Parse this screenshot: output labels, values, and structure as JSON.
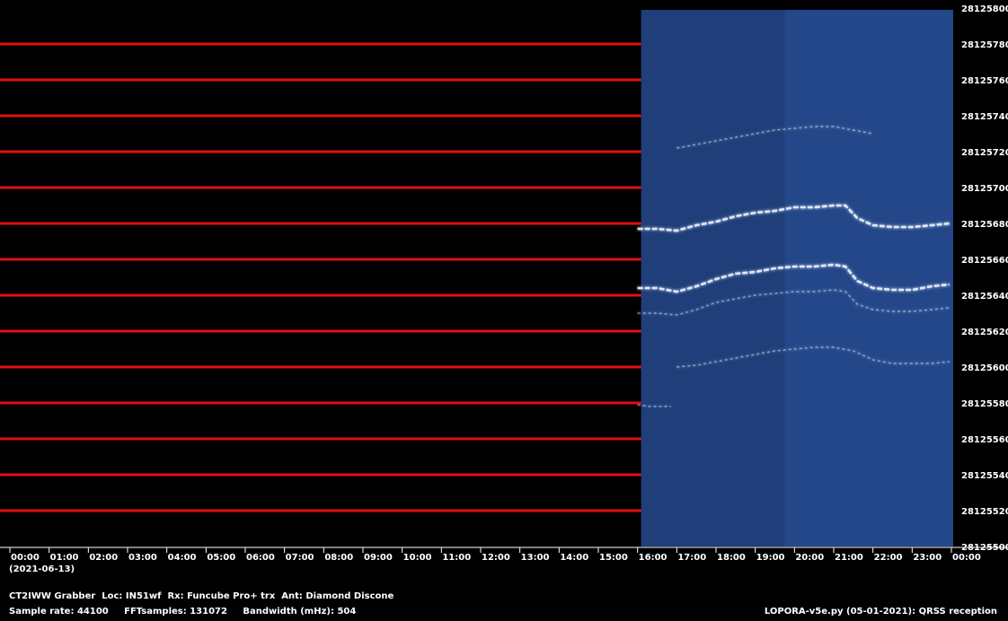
{
  "chart_data": {
    "type": "heatmap",
    "title": "",
    "xlabel": "",
    "ylabel": "",
    "date_label": "(2021-06-13)",
    "x_ticks": [
      "00:00",
      "01:00",
      "02:00",
      "03:00",
      "04:00",
      "05:00",
      "06:00",
      "07:00",
      "08:00",
      "09:00",
      "10:00",
      "11:00",
      "12:00",
      "13:00",
      "14:00",
      "15:00",
      "16:00",
      "17:00",
      "18:00",
      "19:00",
      "20:00",
      "21:00",
      "22:00",
      "23:00",
      "00:00"
    ],
    "x_range_hours": [
      0,
      24
    ],
    "y_ticks": [
      28125500,
      28125520,
      28125540,
      28125560,
      28125580,
      28125600,
      28125620,
      28125640,
      28125660,
      28125680,
      28125700,
      28125720,
      28125740,
      28125760,
      28125780,
      28125800
    ],
    "y_range": [
      28125500,
      28125800
    ],
    "data_start_hour": 16.0,
    "data_end_hour": 24.0,
    "signals": [
      {
        "hours": [
          16.0,
          16.5,
          17.0,
          17.5,
          18.0,
          18.5,
          19.0,
          19.5,
          20.0,
          20.5,
          21.0,
          21.3,
          21.6,
          22.0,
          22.5,
          23.0,
          23.5,
          23.95
        ],
        "values": [
          28125677,
          28125677,
          28125676,
          28125679,
          28125681,
          28125684,
          28125686,
          28125687,
          28125689,
          28125689,
          28125690,
          28125690,
          28125683,
          28125679,
          28125678,
          28125678,
          28125679,
          28125680
        ]
      },
      {
        "hours": [
          16.0,
          16.5,
          17.0,
          17.5,
          18.0,
          18.5,
          19.0,
          19.5,
          20.0,
          20.5,
          21.0,
          21.3,
          21.6,
          22.0,
          22.5,
          23.0,
          23.5,
          23.95
        ],
        "values": [
          28125644,
          28125644,
          28125642,
          28125645,
          28125649,
          28125652,
          28125653,
          28125655,
          28125656,
          28125656,
          28125657,
          28125656,
          28125648,
          28125644,
          28125643,
          28125643,
          28125645,
          28125646
        ]
      },
      {
        "hours": [
          16.0,
          16.5,
          17.0,
          17.5,
          18.0,
          18.5,
          19.0,
          19.5,
          20.0,
          20.5,
          21.0,
          21.3,
          21.6,
          22.0,
          22.5,
          23.0,
          23.5,
          23.95
        ],
        "values": [
          28125630,
          28125630,
          28125629,
          28125632,
          28125636,
          28125638,
          28125640,
          28125641,
          28125642,
          28125642,
          28125643,
          28125642,
          28125635,
          28125632,
          28125631,
          28125631,
          28125632,
          28125633
        ]
      },
      {
        "hours": [
          17.0,
          17.5,
          18.0,
          18.5,
          19.0,
          19.5,
          20.0,
          20.5,
          21.0,
          21.5,
          22.0,
          22.5,
          23.0,
          23.5,
          23.95
        ],
        "values": [
          28125600,
          28125601,
          28125603,
          28125605,
          28125607,
          28125609,
          28125610,
          28125611,
          28125611,
          28125609,
          28125604,
          28125602,
          28125602,
          28125602,
          28125603
        ]
      },
      {
        "hours": [
          17.0,
          17.5,
          18.0,
          18.5,
          19.0,
          19.5,
          20.0,
          20.5,
          21.0,
          21.5,
          22.0
        ],
        "values": [
          28125722,
          28125724,
          28125726,
          28125728,
          28125730,
          28125732,
          28125733,
          28125734,
          28125734,
          28125732,
          28125730
        ]
      },
      {
        "hours": [
          16.0,
          16.3,
          16.6,
          16.85
        ],
        "values": [
          28125579,
          28125578,
          28125578,
          28125578
        ]
      }
    ],
    "grid": true,
    "colors": {
      "background": "#000000",
      "gridline": "#e01010",
      "spectrogram_base": "#24478a",
      "spectrogram_dim": "#1f3d78",
      "signal": "#e8f2ff",
      "text": "#ffffff"
    }
  },
  "footer": {
    "station_line": "CT2IWW Grabber  Loc: IN51wf  Rx: Funcube Pro+ trx  Ant: Diamond Discone",
    "params_line": "Sample rate: 44100     FFTsamples: 131072     Bandwidth (mHz): 504",
    "software_line": "LOPORA-v5e.py (05-01-2021): QRSS reception"
  }
}
